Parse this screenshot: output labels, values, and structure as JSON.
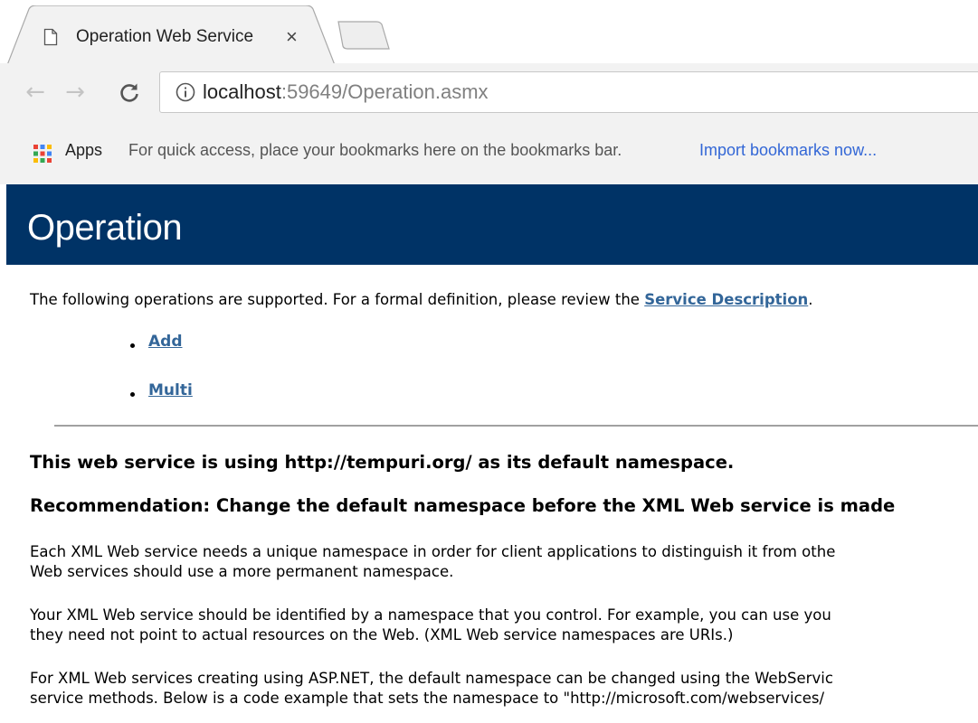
{
  "browser": {
    "tab": {
      "title": "Operation Web Service",
      "close_label": "×"
    },
    "nav": {
      "back": "←",
      "forward": "→",
      "reload": "C"
    },
    "address": {
      "host": "localhost",
      "rest": ":59649/Operation.asmx"
    },
    "bookmarks": {
      "apps_label": "Apps",
      "hint": "For quick access, place your bookmarks here on the bookmarks bar.",
      "import_link": "Import bookmarks now..."
    }
  },
  "page": {
    "title": "Operation",
    "intro_text": "The following operations are supported. For a formal definition, please review the ",
    "intro_link": "Service Description",
    "intro_end": ".",
    "operations": [
      "Add",
      "Multi"
    ],
    "namespace_heading": "This web service is using http://tempuri.org/ as its default namespace.",
    "recommendation_heading": "Recommendation: Change the default namespace before the XML Web service is made",
    "paragraphs": [
      [
        "Each XML Web service needs a unique namespace in order for client applications to distinguish it from othe",
        "Web services should use a more permanent namespace."
      ],
      [
        "Your XML Web service should be identified by a namespace that you control. For example, you can use you",
        "they need not point to actual resources on the Web. (XML Web service namespaces are URIs.)"
      ],
      [
        "For XML Web services creating using ASP.NET, the default namespace can be changed using the WebServic",
        "service methods. Below is a code example that sets the namespace to \"http://microsoft.com/webservices/"
      ]
    ]
  },
  "colors": {
    "header_bg": "#003366",
    "link": "#336699",
    "bookmark_link": "#3367d6"
  }
}
